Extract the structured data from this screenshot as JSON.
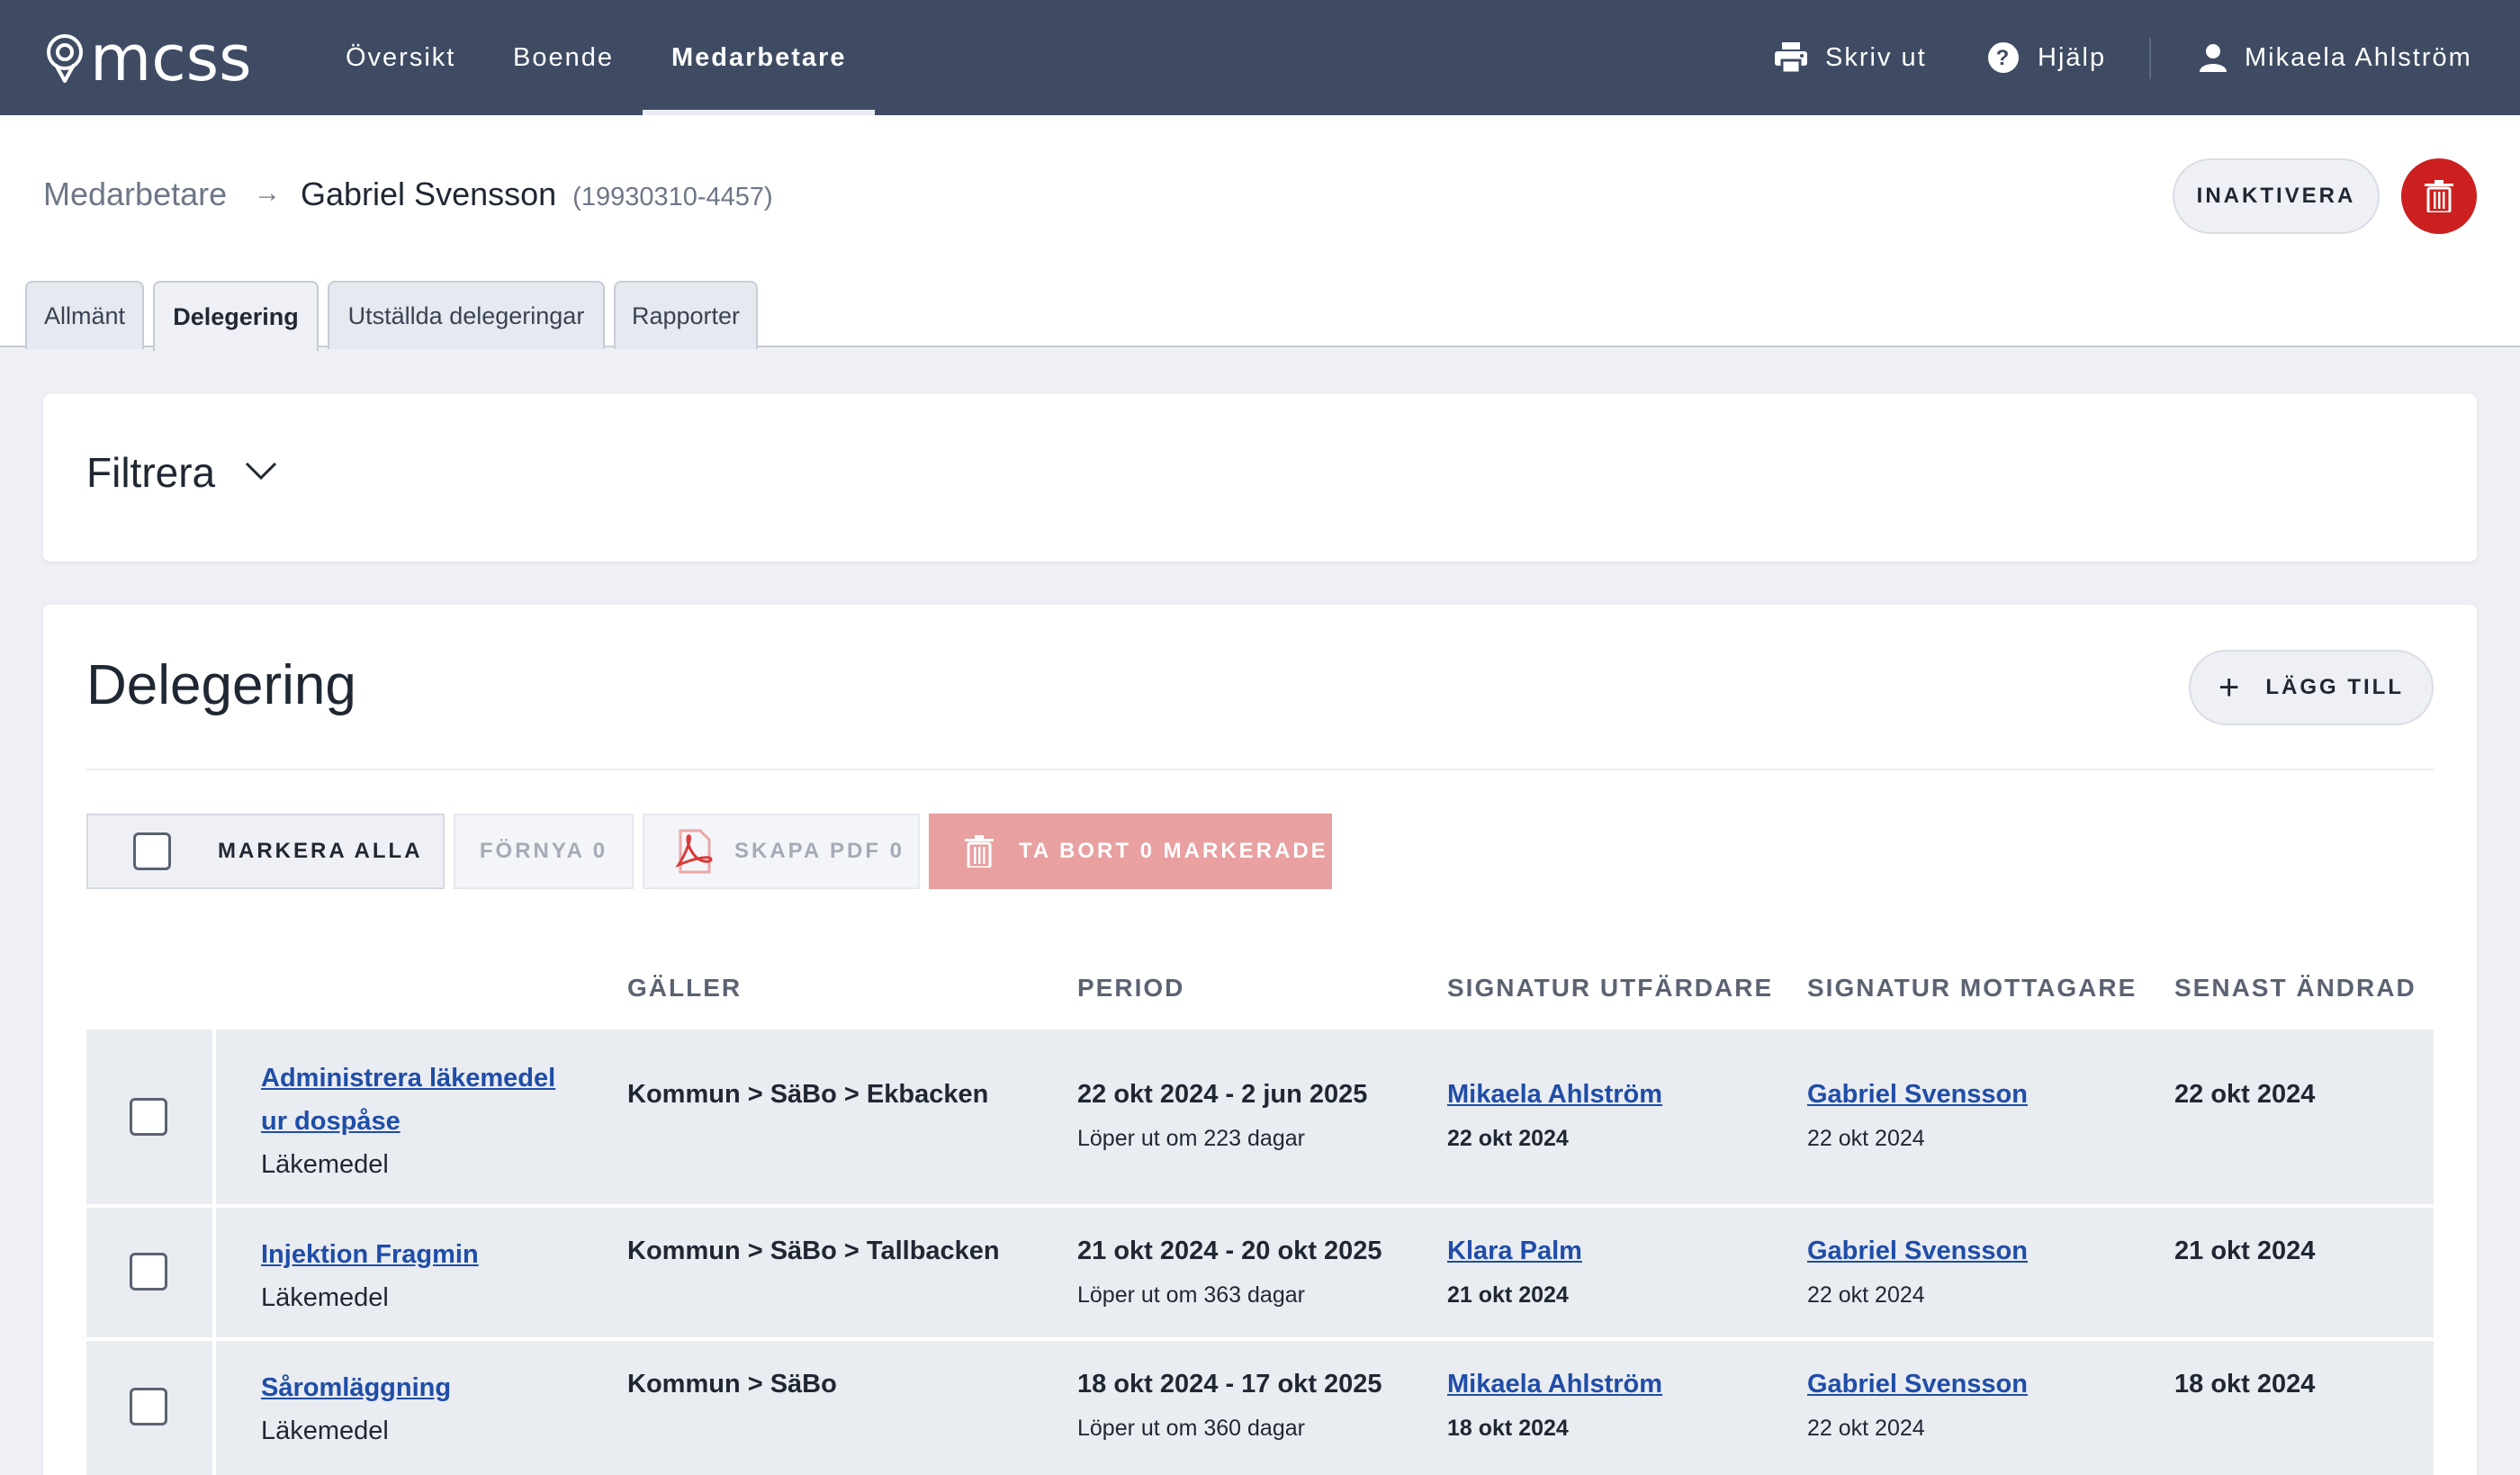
{
  "app": {
    "logo": "mcss"
  },
  "nav": {
    "items": [
      {
        "label": "Översikt"
      },
      {
        "label": "Boende"
      },
      {
        "label": "Medarbetare"
      }
    ]
  },
  "tools": {
    "print": "Skriv ut",
    "help": "Hjälp",
    "user": "Mikaela Ahlström"
  },
  "breadcrumb": {
    "root": "Medarbetare",
    "arrow": "→",
    "name": "Gabriel Svensson",
    "personnummer": "(19930310-4457)"
  },
  "header_actions": {
    "inactivate": "INAKTIVERA"
  },
  "tabs": [
    {
      "label": "Allmänt"
    },
    {
      "label": "Delegering"
    },
    {
      "label": "Utställda delegeringar"
    },
    {
      "label": "Rapporter"
    }
  ],
  "filter": {
    "title": "Filtrera"
  },
  "section": {
    "title": "Delegering",
    "add_label": "LÄGG TILL"
  },
  "bulk_actions": {
    "select_all": "MARKERA ALLA",
    "renew": "FÖRNYA 0",
    "pdf": "SKAPA PDF 0",
    "delete": "TA BORT 0 MARKERADE"
  },
  "table": {
    "headers": {
      "galler": "GÄLLER",
      "period": "PERIOD",
      "sig_utfardare": "SIGNATUR UTFÄRDARE",
      "sig_mottagare": "SIGNATUR MOTTAGARE",
      "senast_andrad": "SENAST ÄNDRAD"
    },
    "rows": [
      {
        "title_line1": "Administrera läkemedel",
        "title_line2": "ur dospåse",
        "category": "Läkemedel",
        "galler": "Kommun > SäBo > Ekbacken",
        "period": "22 okt 2024 - 2 jun 2025",
        "expires": "Löper ut om 223 dagar",
        "issuer": "Mikaela Ahlström",
        "issuer_date": "22 okt 2024",
        "receiver": "Gabriel Svensson",
        "receiver_date": "22 okt 2024",
        "changed": "22 okt 2024"
      },
      {
        "title_line1": "Injektion Fragmin",
        "category": "Läkemedel",
        "galler": "Kommun > SäBo > Tallbacken",
        "period": "21 okt 2024 - 20 okt 2025",
        "expires": "Löper ut om 363 dagar",
        "issuer": "Klara Palm",
        "issuer_date": "21 okt 2024",
        "receiver": "Gabriel Svensson",
        "receiver_date": "22 okt 2024",
        "changed": "21 okt 2024"
      },
      {
        "title_line1": "Såromläggning",
        "category": "Läkemedel",
        "galler": "Kommun > SäBo",
        "period": "18 okt 2024 - 17 okt 2025",
        "expires": "Löper ut om 360 dagar",
        "issuer": "Mikaela Ahlström",
        "issuer_date": "18 okt 2024",
        "receiver": "Gabriel Svensson",
        "receiver_date": "22 okt 2024",
        "changed": "18 okt 2024"
      }
    ]
  },
  "colors": {
    "topbar": "#3e4b63",
    "danger": "#cc1f1f",
    "link": "#1f4da8",
    "delete_disabled": "#e8a0a0"
  }
}
